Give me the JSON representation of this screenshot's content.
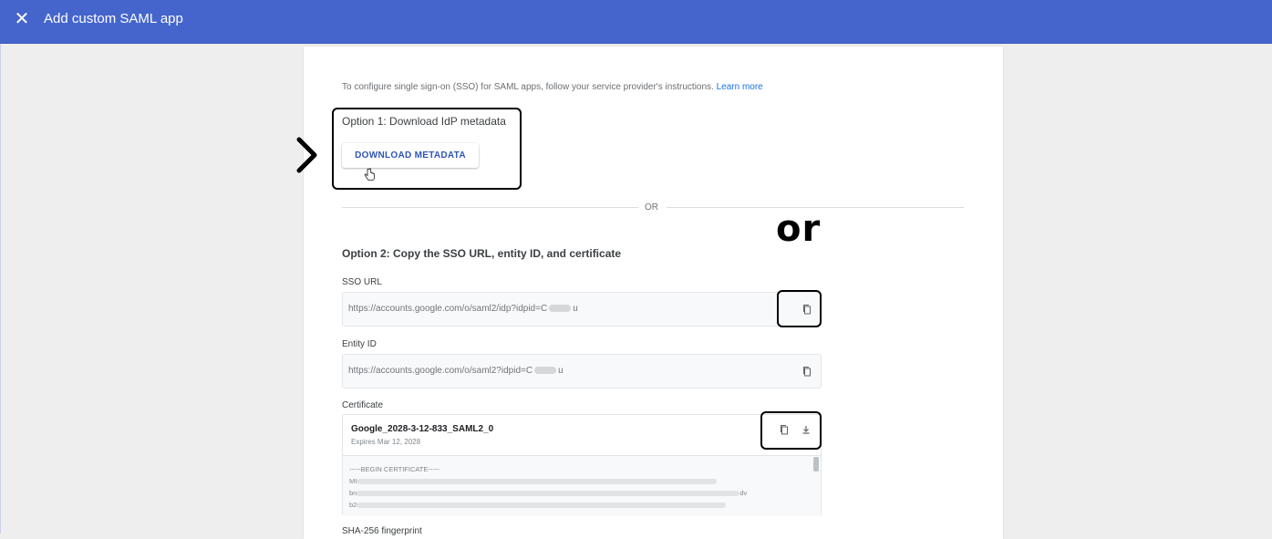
{
  "header": {
    "title": "Add custom SAML app",
    "close_icon": "close-icon",
    "bar_color": "#4565cd"
  },
  "intro": {
    "text": "To configure single sign-on (SSO) for SAML apps, follow your service provider's instructions.",
    "link": "Learn more"
  },
  "option1": {
    "title": "Option 1: Download IdP metadata",
    "button": "DOWNLOAD METADATA"
  },
  "divider_label": "OR",
  "annotation_or": "or",
  "option2": {
    "title": "Option 2: Copy the SSO URL, entity ID, and certificate",
    "sso_url": {
      "label": "SSO URL",
      "value_prefix": "https://accounts.google.com/o/saml2/idp?idpid=C",
      "value_suffix": "u"
    },
    "entity_id": {
      "label": "Entity ID",
      "value_prefix": "https://accounts.google.com/o/saml2?idpid=C",
      "value_suffix": "u"
    },
    "certificate": {
      "label": "Certificate",
      "name": "Google_2028-3-12-833_SAML2_0",
      "expires": "Expires Mar 12, 2028",
      "begin": "-----BEGIN CERTIFICATE-----",
      "line2_prefix": "MI",
      "line3_prefix": "bn",
      "line3_suffix": "dv",
      "line4_prefix": "b2"
    },
    "sha_label": "SHA-256 fingerprint"
  }
}
